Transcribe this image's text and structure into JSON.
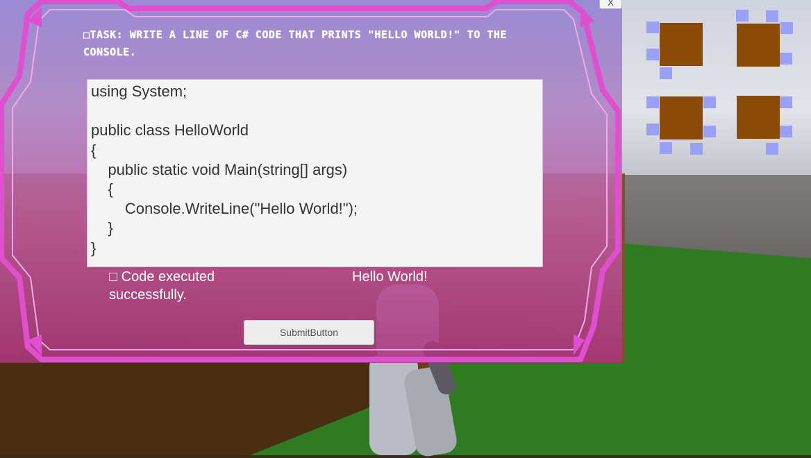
{
  "colors": {
    "panel_border": "#e04fd0",
    "code_bg": "#f4f4f4",
    "room": "#8b4a06",
    "door": "#9aa0f5",
    "grass": "#2f7a23"
  },
  "task_panel": {
    "task": "□TASK: WRITE A LINE OF C# CODE THAT PRINTS \"HELLO WORLD!\" TO THE CONSOLE.",
    "code": "using System;\n\npublic class HelloWorld\n{\n    public static void Main(string[] args)\n    {\n        Console.WriteLine(\"Hello World!\");\n    }\n}",
    "status": "□ Code executed successfully.",
    "output": "Hello World!",
    "submit_label": "SubmitButton",
    "close_label": "X"
  },
  "minimap": {
    "room_icon": "room-square-icon",
    "door_icon": "door-marker-icon",
    "rooms": 4
  }
}
